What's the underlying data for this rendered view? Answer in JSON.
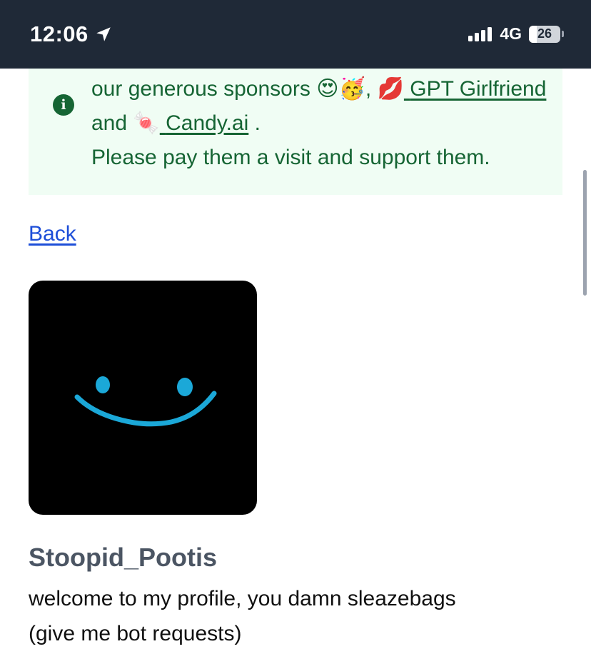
{
  "status_bar": {
    "time": "12:06",
    "network": "4G",
    "battery_level": "26",
    "battery_fraction": 0.26,
    "icons": [
      "location-arrow-icon",
      "signal-icon",
      "battery-icon"
    ]
  },
  "notice": {
    "icon": "info-icon",
    "line1_text": "our generous sponsors",
    "emoji_1": "😍",
    "emoji_2": "🥳",
    "comma": ",",
    "sponsor1_emoji": "💋",
    "sponsor1_name": "GPT Girlfriend",
    "and_text": "and",
    "sponsor2_emoji": "🍬",
    "sponsor2_name": "Candy.ai",
    "period": ".",
    "line3_text": "Please pay them a visit and support them.",
    "colors": {
      "background": "#f0fdf4",
      "text": "#166534"
    }
  },
  "back_link": "Back",
  "profile": {
    "avatar": "smiley-face-avatar",
    "username": "Stoopid_Pootis",
    "bio_line1": "welcome to my profile, you damn sleazebags",
    "bio_line2": "(give me bot requests)"
  },
  "colors": {
    "status_bar": "#1f2937",
    "link": "#1d4ed8",
    "username": "#4b5563",
    "avatar_smile": "#1ba8d8"
  }
}
